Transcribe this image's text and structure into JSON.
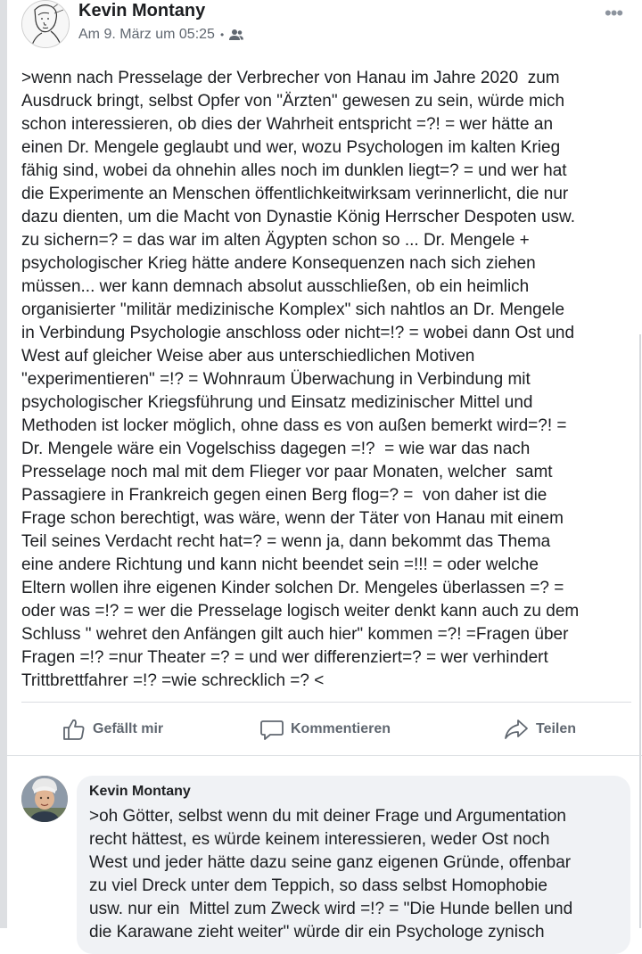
{
  "post": {
    "author": "Kevin Montany",
    "timestamp": "Am 9. März um 05:25",
    "audience_icon": "friends-icon",
    "body_lines": [
      ">wenn nach Presselage der Verbrecher von Hanau im Jahre 2020  zum",
      "Ausdruck bringt, selbst Opfer von \"Ärzten\" gewesen zu sein, würde mich",
      "schon interessieren, ob dies der Wahrheit entspricht =?! = wer hätte an",
      "einen Dr. Mengele geglaubt und wer, wozu Psychologen im kalten Krieg",
      "fähig sind, wobei da ohnehin alles noch im dunklen liegt=? = und wer hat",
      "die Experimente an Menschen öffentlichkeitwirksam verinnerlicht, die nur",
      "dazu dienten, um die Macht von Dynastie König Herrscher Despoten usw.",
      "zu sichern=? = das war im alten Ägypten schon so ... Dr. Mengele +",
      "psychologischer Krieg hätte andere Konsequenzen nach sich ziehen",
      "müssen... wer kann demnach absolut ausschließen, ob ein heimlich",
      "organisierter \"militär medizinische Komplex\" sich nahtlos an Dr. Mengele",
      "in Verbindung Psychologie anschloss oder nicht=!? = wobei dann Ost und",
      "West auf gleicher Weise aber aus unterschiedlichen Motiven",
      "\"experimentieren\" =!? = Wohnraum Überwachung in Verbindung mit",
      "psychologischer Kriegsführung und Einsatz medizinischer Mittel und",
      "Methoden ist locker möglich, ohne dass es von außen bemerkt wird=?! =",
      "Dr. Mengele wäre ein Vogelschiss dagegen =!?  = wie war das nach",
      "Presselage noch mal mit dem Flieger vor paar Monaten, welcher  samt",
      "Passagiere in Frankreich gegen einen Berg flog=? =  von daher ist die",
      "Frage schon berechtigt, was wäre, wenn der Täter von Hanau mit einem",
      "Teil seines Verdacht recht hat=? = wenn ja, dann bekommt das Thema",
      "eine andere Richtung und kann nicht beendet sein =!!! = oder welche",
      "Eltern wollen ihre eigenen Kinder solchen Dr. Mengeles überlassen =? =",
      "oder was =!? = wer die Presselage logisch weiter denkt kann auch zu dem",
      "Schluss \" wehret den Anfängen gilt auch hier\" kommen =?! =Fragen über",
      "Fragen =!? =nur Theater =? = und wer differenziert=? = wer verhindert",
      "Trittbrettfahrer =!? =wie schrecklich =? <"
    ]
  },
  "actions": {
    "like": "Gefällt mir",
    "comment": "Kommentieren",
    "share": "Teilen"
  },
  "comment": {
    "author": "Kevin Montany",
    "body_lines": [
      ">oh Götter, selbst wenn du mit deiner Frage und Argumentation",
      "recht hättest, es würde keinem interessieren, weder Ost noch",
      "West und jeder hätte dazu seine ganz eigenen Gründe, offenbar",
      "zu viel Dreck unter dem Teppich, so dass selbst Homophobie",
      "usw. nur ein  Mittel zum Zweck wird =!? = \"Die Hunde bellen und",
      "die Karawane zieht weiter\" würde dir ein Psychologe zynisch"
    ]
  },
  "colors": {
    "text": "#1c1e21",
    "secondary": "#606770",
    "bubble": "#f0f2f5",
    "divider": "#dadde1"
  }
}
